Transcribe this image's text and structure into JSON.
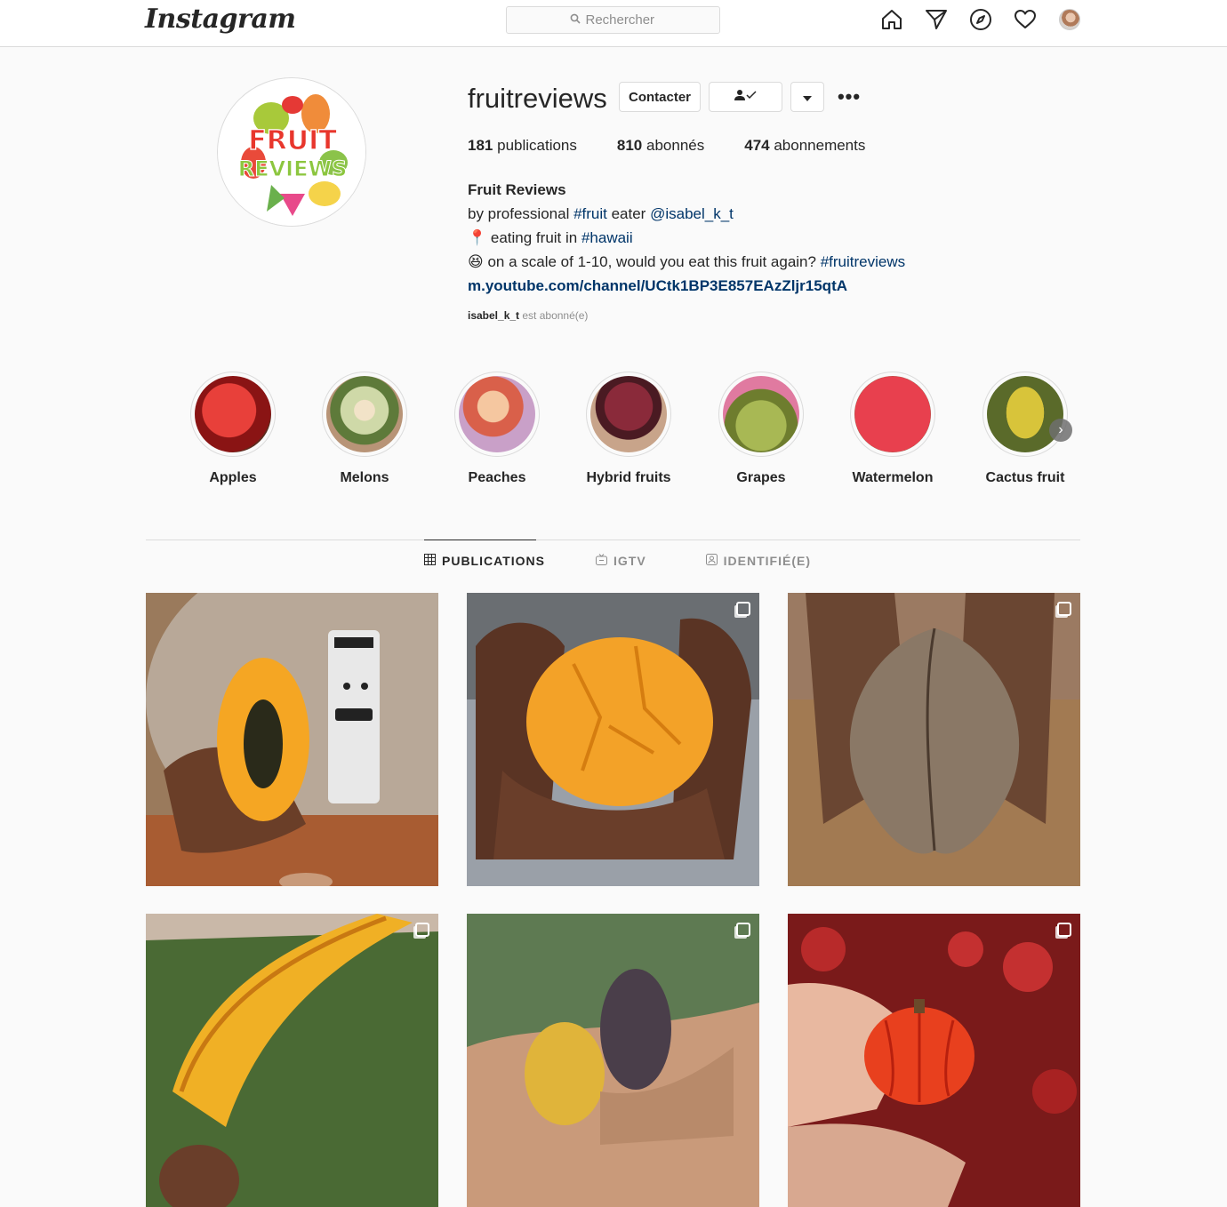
{
  "nav": {
    "logo": "Instagram",
    "search_placeholder": "Rechercher",
    "icons": [
      "home-icon",
      "direct-icon",
      "explore-icon",
      "activity-icon",
      "profile-avatar"
    ]
  },
  "profile": {
    "username": "fruitreviews",
    "contact_label": "Contacter",
    "stats": {
      "posts_count": "181",
      "posts_label": "publications",
      "followers_count": "810",
      "followers_label": "abonnés",
      "following_count": "474",
      "following_label": "abonnements"
    },
    "bio": {
      "name": "Fruit Reviews",
      "line1_prefix": "by professional ",
      "line1_tag": "#fruit",
      "line1_mid": " eater ",
      "line1_mention": "@isabel_k_t",
      "line2_emoji": "📍",
      "line2_text": " eating fruit in ",
      "line2_tag": "#hawaii",
      "line3_emoji": "😆",
      "line3_text": " on a scale of 1-10, would you eat this fruit again? ",
      "line3_tag": "#fruitreviews",
      "link": "m.youtube.com/channel/UCtk1BP3E857EAzZljr15qtA"
    },
    "followed_by_user": "isabel_k_t",
    "followed_by_text": " est abonné(e)"
  },
  "highlights": [
    {
      "label": "Apples",
      "color": "#c8232c"
    },
    {
      "label": "Melons",
      "color": "#8a9a5b"
    },
    {
      "label": "Peaches",
      "color": "#e8a07a"
    },
    {
      "label": "Hybrid fruits",
      "color": "#6b1e2a"
    },
    {
      "label": "Grapes",
      "color": "#9aaa4a"
    },
    {
      "label": "Watermelon",
      "color": "#d8334a"
    },
    {
      "label": "Cactus fruit",
      "color": "#c9b437"
    }
  ],
  "tabs": [
    {
      "label": "PUBLICATIONS",
      "icon": "grid-icon",
      "active": true
    },
    {
      "label": "IGTV",
      "icon": "igtv-icon",
      "active": false
    },
    {
      "label": "IDENTIFIÉ(E)",
      "icon": "tagged-icon",
      "active": false
    }
  ],
  "posts": [
    {
      "subject": "papaya",
      "multi": false
    },
    {
      "subject": "orange-fruit",
      "multi": true
    },
    {
      "subject": "brown-seed",
      "multi": true
    },
    {
      "subject": "yellow-pod",
      "multi": true
    },
    {
      "subject": "small-fruits",
      "multi": true
    },
    {
      "subject": "red-ribbed-fruit",
      "multi": true
    }
  ]
}
